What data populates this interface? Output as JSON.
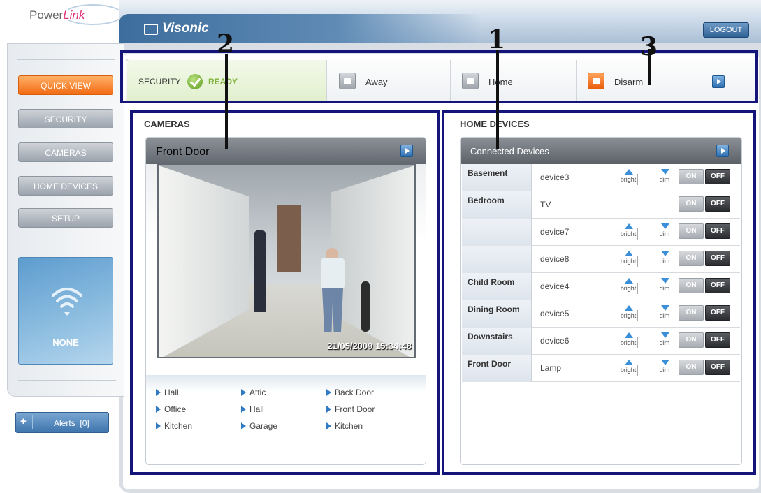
{
  "logo": {
    "prefix": "Power",
    "accent": "Link"
  },
  "brand": "Visonic",
  "logout_label": "LOGOUT",
  "nav": [
    {
      "label": "QUICK VIEW",
      "active": true
    },
    {
      "label": "SECURITY",
      "active": false
    },
    {
      "label": "CAMERAS",
      "active": false
    },
    {
      "label": "HOME DEVICES",
      "active": false
    },
    {
      "label": "SETUP",
      "active": false
    }
  ],
  "status": {
    "icon": "wifi-icon",
    "label": "NONE"
  },
  "alerts": {
    "plus": "+",
    "label": "Alerts",
    "count": "[0]"
  },
  "security": {
    "title": "SECURITY",
    "state": "READY",
    "modes": [
      {
        "label": "Away",
        "icon": "lock-icon"
      },
      {
        "label": "Home",
        "icon": "home-icon"
      },
      {
        "label": "Disarm",
        "icon": "unlock-icon"
      }
    ]
  },
  "cameras": {
    "heading": "CAMERAS",
    "current": "Front Door",
    "timestamp": "21/05/2009 15:34:48",
    "links": [
      [
        "Hall",
        "Attic",
        "Back Door"
      ],
      [
        "Office",
        "Hall",
        "Front Door"
      ],
      [
        "Kitchen",
        "Garage",
        "Kitchen"
      ]
    ]
  },
  "home_devices": {
    "heading": "HOME DEVICES",
    "subheading": "Connected Devices",
    "bright_label": "bright",
    "dim_label": "dim",
    "on_label": "ON",
    "off_label": "OFF",
    "rows": [
      {
        "room": "Basement",
        "device": "device3",
        "dimmable": true
      },
      {
        "room": "Bedroom",
        "device": "TV",
        "dimmable": false
      },
      {
        "room": "",
        "device": "device7",
        "dimmable": true
      },
      {
        "room": "",
        "device": "device8",
        "dimmable": true
      },
      {
        "room": "Child Room",
        "device": "device4",
        "dimmable": true
      },
      {
        "room": "Dining Room",
        "device": "device5",
        "dimmable": true
      },
      {
        "room": "Downstairs",
        "device": "device6",
        "dimmable": true
      },
      {
        "room": "Front Door",
        "device": "Lamp",
        "dimmable": true
      }
    ]
  },
  "callouts": [
    "1",
    "2",
    "3"
  ],
  "colors": {
    "accent": "#f26b14",
    "outline": "#14147a",
    "ready": "#7fb33a",
    "brand": "#3d6d9d"
  }
}
